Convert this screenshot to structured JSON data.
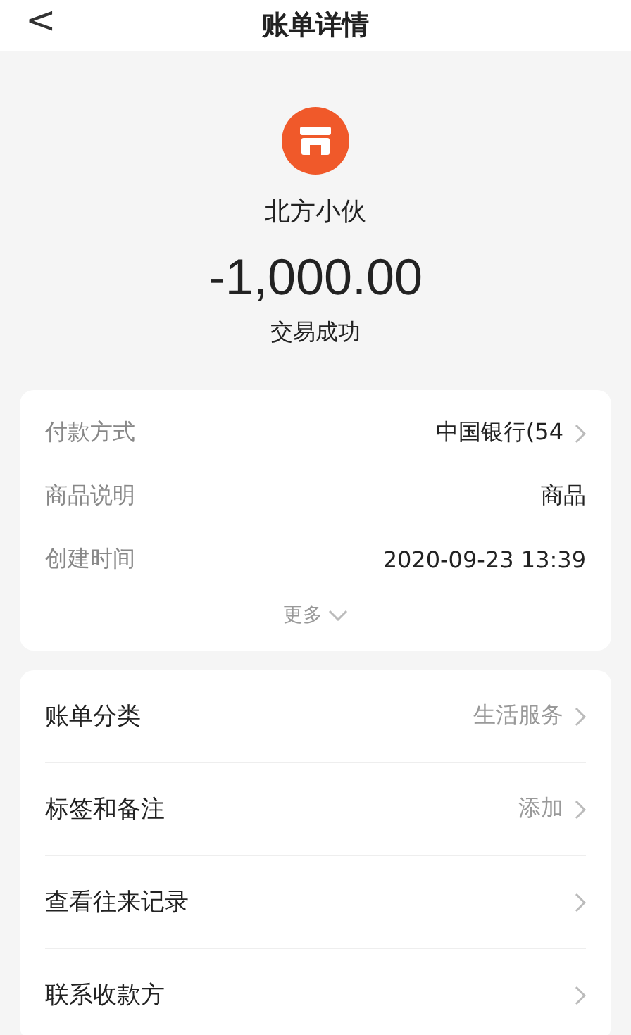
{
  "header": {
    "back": "<",
    "title": "账单详情"
  },
  "merchant": {
    "name": "北方小伙",
    "amount": "-1,000.00",
    "status": "交易成功"
  },
  "details": [
    {
      "label": "付款方式",
      "value": "中国银行(54",
      "arrow": true
    },
    {
      "label": "商品说明",
      "value": "商品",
      "arrow": false
    },
    {
      "label": "创建时间",
      "value": "2020-09-23 13:39",
      "arrow": false
    }
  ],
  "more": "更多",
  "actions": [
    {
      "label": "账单分类",
      "value": "生活服务"
    },
    {
      "label": "标签和备注",
      "value": "添加"
    },
    {
      "label": "查看往来记录"
    },
    {
      "label": "联系收款方"
    }
  ]
}
